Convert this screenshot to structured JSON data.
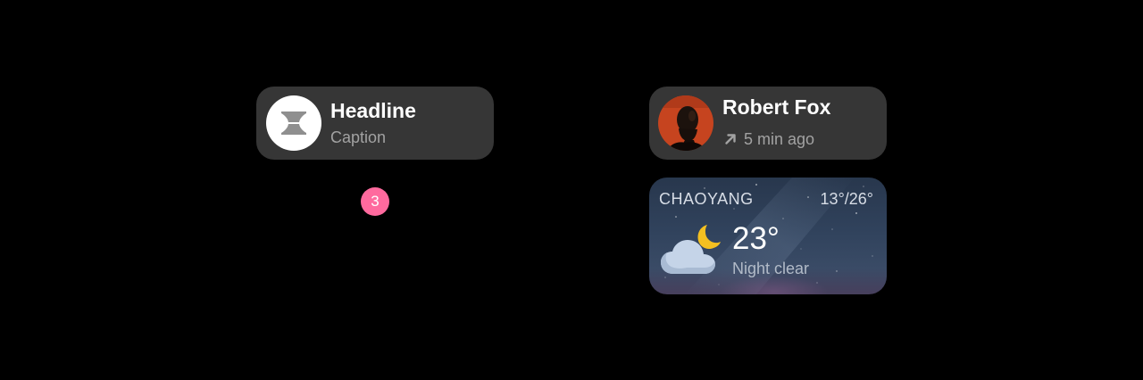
{
  "widget": {
    "headline": "Headline",
    "caption": "Caption"
  },
  "badge": {
    "count": "3",
    "color": "#ff6a9e"
  },
  "contact": {
    "name": "Robert Fox",
    "time": "5 min ago",
    "status_icon": "arrow-up-right-icon",
    "avatar_bg": "#c6441f"
  },
  "weather": {
    "city": "CHAOYANG",
    "range": "13°/26°",
    "temp": "23°",
    "condition": "Night clear",
    "icon": "cloud-moon-icon"
  }
}
